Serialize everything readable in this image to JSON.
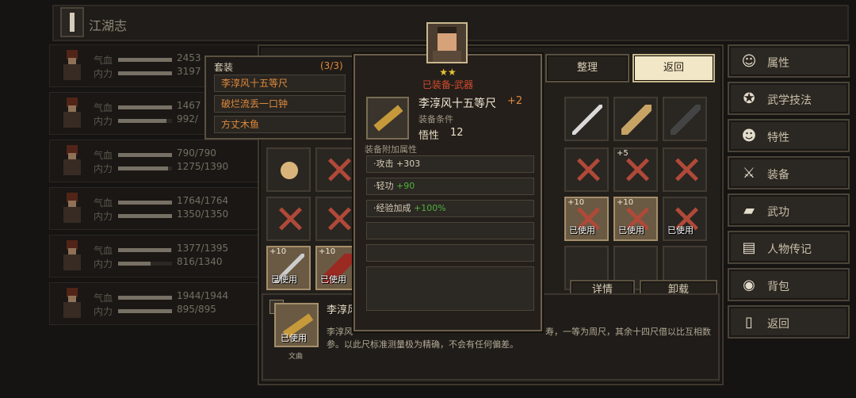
{
  "header": {
    "title": "江湖志"
  },
  "characters": [
    {
      "hp_label": "气血",
      "mp_label": "内力",
      "hp": "2453",
      "mp": "3197",
      "hpfill": 1,
      "mpfill": 1
    },
    {
      "hp_label": "气血",
      "mp_label": "内力",
      "hp": "1467",
      "mp": "992/",
      "hpfill": 1,
      "mpfill": 0.9
    },
    {
      "hp_label": "气血",
      "mp_label": "内力",
      "hp": "790/790",
      "mp": "1275/1390",
      "hpfill": 1,
      "mpfill": 0.92
    },
    {
      "hp_label": "气血",
      "mp_label": "内力",
      "hp": "1764/1764",
      "mp": "1350/1350",
      "hpfill": 1,
      "mpfill": 1
    },
    {
      "hp_label": "气血",
      "mp_label": "内力",
      "hp": "1377/1395",
      "mp": "816/1340",
      "hpfill": 0.99,
      "mpfill": 0.61
    },
    {
      "hp_label": "气血",
      "mp_label": "内力",
      "hp": "1944/1944",
      "mp": "895/895",
      "hpfill": 1,
      "mpfill": 1
    }
  ],
  "nav": [
    {
      "label": "属性",
      "icon": "character-icon"
    },
    {
      "label": "武学技法",
      "icon": "martial-skill-icon"
    },
    {
      "label": "特性",
      "icon": "trait-icon"
    },
    {
      "label": "装备",
      "icon": "sword-icon"
    },
    {
      "label": "武功",
      "icon": "book-icon"
    },
    {
      "label": "人物传记",
      "icon": "scroll-icon"
    },
    {
      "label": "背包",
      "icon": "bag-icon"
    },
    {
      "label": "返回",
      "icon": "exit-icon"
    }
  ],
  "inventory": {
    "sort_button": "整理",
    "back_button": "返回",
    "detail_button": "详情",
    "unequip_button": "卸载",
    "used_label": "已使用",
    "plus10": "+10",
    "plus5": "+5"
  },
  "set_panel": {
    "title": "套装",
    "count": "(3/3)",
    "items": [
      "李淳风十五等尺",
      "破烂流丢一口钟",
      "方丈木鱼"
    ]
  },
  "popup": {
    "stars": "★★",
    "status": "已装备-武器",
    "item_name": "李淳风十五等尺",
    "level": "+2",
    "req_label": "装备条件",
    "req_attr": "悟性",
    "req_value": "12",
    "extra_label": "装备附加属性",
    "props": [
      {
        "name": "·攻击",
        "value": "+303",
        "color": "#d7cdb8"
      },
      {
        "name": "·轻功",
        "value": "+90",
        "color": "#4fb23c"
      },
      {
        "name": "·经验加成",
        "value": "+100%",
        "color": "#4fb23c"
      }
    ]
  },
  "desc": {
    "name": "李淳风",
    "text1": "李淳风",
    "text1b": "寿，一等为周尺，其余十四尺借以比互相数",
    "text2": "参。以此尺标准测量极为精确，不会有任何偏差。",
    "used": "已使用",
    "sublabel": "文曲"
  }
}
